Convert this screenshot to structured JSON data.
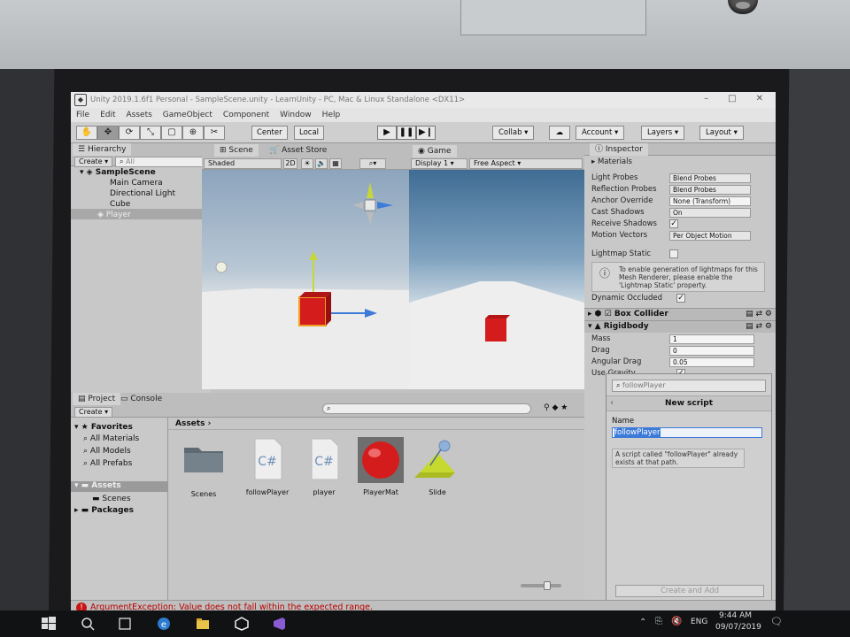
{
  "window": {
    "title": "Unity 2019.1.6f1 Personal - SampleScene.unity - LearnUnity - PC, Mac & Linux Standalone <DX11>",
    "menu": [
      "File",
      "Edit",
      "Assets",
      "GameObject",
      "Component",
      "Window",
      "Help"
    ]
  },
  "toolbar": {
    "pivot_center": "Center",
    "pivot_local": "Local",
    "collab": "Collab",
    "account": "Account",
    "layers": "Layers",
    "layout": "Layout"
  },
  "hierarchy": {
    "tab": "Hierarchy",
    "create": "Create",
    "search_placeholder": "All",
    "scene": "SampleScene",
    "items": [
      "Main Camera",
      "Directional Light",
      "Cube",
      "Player"
    ]
  },
  "scene_view": {
    "tab": "Scene",
    "tab_store": "Asset Store",
    "shading": "Shaded",
    "mode_2d": "2D"
  },
  "game_view": {
    "tab": "Game",
    "display": "Display 1",
    "aspect": "Free Aspect"
  },
  "inspector": {
    "tab": "Inspector",
    "section": "Materials",
    "rows": [
      {
        "label": "Light Probes",
        "value": "Blend Probes"
      },
      {
        "label": "Reflection Probes",
        "value": "Blend Probes"
      },
      {
        "label": "Anchor Override",
        "value": "None (Transform)"
      },
      {
        "label": "Cast Shadows",
        "value": "On"
      },
      {
        "label": "Receive Shadows",
        "value": ""
      },
      {
        "label": "Motion Vectors",
        "value": "Per Object Motion"
      }
    ],
    "lightmap_static": "Lightmap Static",
    "info": "To enable generation of lightmaps for this Mesh Renderer, please enable the 'Lightmap Static' property.",
    "dynamic_occluded": "Dynamic Occluded",
    "box_collider": "Box Collider",
    "rigidbody": "Rigidbody",
    "rigidbody_rows": [
      {
        "label": "Mass",
        "value": "1"
      },
      {
        "label": "Drag",
        "value": "0"
      },
      {
        "label": "Angular Drag",
        "value": "0.05"
      }
    ],
    "use_gravity": "Use Gravity"
  },
  "add_component": {
    "search_value": "followPlayer",
    "title": "New script",
    "name_label": "Name",
    "name_value": "followPlayer",
    "warning": "A script called \"followPlayer\" already exists at that path.",
    "button": "Create and Add"
  },
  "project": {
    "tab": "Project",
    "tab_console": "Console",
    "create": "Create",
    "favorites": "Favorites",
    "favorite_items": [
      "All Materials",
      "All Models",
      "All Prefabs"
    ],
    "assets_root": "Assets",
    "asset_folders": [
      "Scenes"
    ],
    "packages": "Packages",
    "breadcrumb": "Assets",
    "assets": [
      {
        "name": "Scenes",
        "kind": "folder"
      },
      {
        "name": "followPlayer",
        "kind": "script"
      },
      {
        "name": "player",
        "kind": "script"
      },
      {
        "name": "PlayerMat",
        "kind": "material"
      },
      {
        "name": "Slide",
        "kind": "physics-material"
      }
    ],
    "script_glyph": "C#"
  },
  "status": {
    "error": "ArgumentException: Value does not fall within the expected range."
  },
  "taskbar": {
    "language": "ENG",
    "time": "9:44 AM",
    "date": "09/07/2019"
  },
  "colors": {
    "player_red": "#d41c1c",
    "selection_blue": "#3d7bd8",
    "error_red": "#c81414"
  }
}
